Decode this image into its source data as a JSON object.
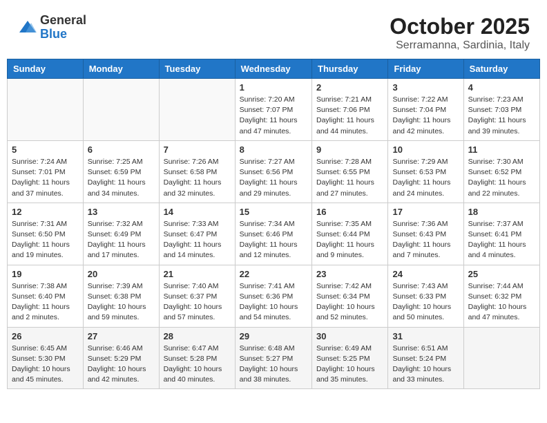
{
  "header": {
    "logo_general": "General",
    "logo_blue": "Blue",
    "month_title": "October 2025",
    "subtitle": "Serramanna, Sardinia, Italy"
  },
  "weekdays": [
    "Sunday",
    "Monday",
    "Tuesday",
    "Wednesday",
    "Thursday",
    "Friday",
    "Saturday"
  ],
  "weeks": [
    [
      {
        "day": "",
        "info": ""
      },
      {
        "day": "",
        "info": ""
      },
      {
        "day": "",
        "info": ""
      },
      {
        "day": "1",
        "info": "Sunrise: 7:20 AM\nSunset: 7:07 PM\nDaylight: 11 hours\nand 47 minutes."
      },
      {
        "day": "2",
        "info": "Sunrise: 7:21 AM\nSunset: 7:06 PM\nDaylight: 11 hours\nand 44 minutes."
      },
      {
        "day": "3",
        "info": "Sunrise: 7:22 AM\nSunset: 7:04 PM\nDaylight: 11 hours\nand 42 minutes."
      },
      {
        "day": "4",
        "info": "Sunrise: 7:23 AM\nSunset: 7:03 PM\nDaylight: 11 hours\nand 39 minutes."
      }
    ],
    [
      {
        "day": "5",
        "info": "Sunrise: 7:24 AM\nSunset: 7:01 PM\nDaylight: 11 hours\nand 37 minutes."
      },
      {
        "day": "6",
        "info": "Sunrise: 7:25 AM\nSunset: 6:59 PM\nDaylight: 11 hours\nand 34 minutes."
      },
      {
        "day": "7",
        "info": "Sunrise: 7:26 AM\nSunset: 6:58 PM\nDaylight: 11 hours\nand 32 minutes."
      },
      {
        "day": "8",
        "info": "Sunrise: 7:27 AM\nSunset: 6:56 PM\nDaylight: 11 hours\nand 29 minutes."
      },
      {
        "day": "9",
        "info": "Sunrise: 7:28 AM\nSunset: 6:55 PM\nDaylight: 11 hours\nand 27 minutes."
      },
      {
        "day": "10",
        "info": "Sunrise: 7:29 AM\nSunset: 6:53 PM\nDaylight: 11 hours\nand 24 minutes."
      },
      {
        "day": "11",
        "info": "Sunrise: 7:30 AM\nSunset: 6:52 PM\nDaylight: 11 hours\nand 22 minutes."
      }
    ],
    [
      {
        "day": "12",
        "info": "Sunrise: 7:31 AM\nSunset: 6:50 PM\nDaylight: 11 hours\nand 19 minutes."
      },
      {
        "day": "13",
        "info": "Sunrise: 7:32 AM\nSunset: 6:49 PM\nDaylight: 11 hours\nand 17 minutes."
      },
      {
        "day": "14",
        "info": "Sunrise: 7:33 AM\nSunset: 6:47 PM\nDaylight: 11 hours\nand 14 minutes."
      },
      {
        "day": "15",
        "info": "Sunrise: 7:34 AM\nSunset: 6:46 PM\nDaylight: 11 hours\nand 12 minutes."
      },
      {
        "day": "16",
        "info": "Sunrise: 7:35 AM\nSunset: 6:44 PM\nDaylight: 11 hours\nand 9 minutes."
      },
      {
        "day": "17",
        "info": "Sunrise: 7:36 AM\nSunset: 6:43 PM\nDaylight: 11 hours\nand 7 minutes."
      },
      {
        "day": "18",
        "info": "Sunrise: 7:37 AM\nSunset: 6:41 PM\nDaylight: 11 hours\nand 4 minutes."
      }
    ],
    [
      {
        "day": "19",
        "info": "Sunrise: 7:38 AM\nSunset: 6:40 PM\nDaylight: 11 hours\nand 2 minutes."
      },
      {
        "day": "20",
        "info": "Sunrise: 7:39 AM\nSunset: 6:38 PM\nDaylight: 10 hours\nand 59 minutes."
      },
      {
        "day": "21",
        "info": "Sunrise: 7:40 AM\nSunset: 6:37 PM\nDaylight: 10 hours\nand 57 minutes."
      },
      {
        "day": "22",
        "info": "Sunrise: 7:41 AM\nSunset: 6:36 PM\nDaylight: 10 hours\nand 54 minutes."
      },
      {
        "day": "23",
        "info": "Sunrise: 7:42 AM\nSunset: 6:34 PM\nDaylight: 10 hours\nand 52 minutes."
      },
      {
        "day": "24",
        "info": "Sunrise: 7:43 AM\nSunset: 6:33 PM\nDaylight: 10 hours\nand 50 minutes."
      },
      {
        "day": "25",
        "info": "Sunrise: 7:44 AM\nSunset: 6:32 PM\nDaylight: 10 hours\nand 47 minutes."
      }
    ],
    [
      {
        "day": "26",
        "info": "Sunrise: 6:45 AM\nSunset: 5:30 PM\nDaylight: 10 hours\nand 45 minutes."
      },
      {
        "day": "27",
        "info": "Sunrise: 6:46 AM\nSunset: 5:29 PM\nDaylight: 10 hours\nand 42 minutes."
      },
      {
        "day": "28",
        "info": "Sunrise: 6:47 AM\nSunset: 5:28 PM\nDaylight: 10 hours\nand 40 minutes."
      },
      {
        "day": "29",
        "info": "Sunrise: 6:48 AM\nSunset: 5:27 PM\nDaylight: 10 hours\nand 38 minutes."
      },
      {
        "day": "30",
        "info": "Sunrise: 6:49 AM\nSunset: 5:25 PM\nDaylight: 10 hours\nand 35 minutes."
      },
      {
        "day": "31",
        "info": "Sunrise: 6:51 AM\nSunset: 5:24 PM\nDaylight: 10 hours\nand 33 minutes."
      },
      {
        "day": "",
        "info": ""
      }
    ]
  ]
}
